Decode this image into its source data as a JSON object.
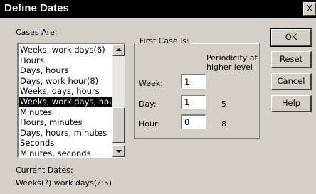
{
  "window": {
    "title": "Define Dates",
    "close_glyph": "X"
  },
  "cases_are": {
    "label": "Cases Are:",
    "items": [
      "Weeks, work days(6)",
      "Hours",
      "Days, hours",
      "Days, work hour(8)",
      "Weeks, days, hours",
      "Weeks, work days, hour",
      "Minutes",
      "Hours, minutes",
      "Days, hours, minutes",
      "Seconds",
      "Minutes, seconds"
    ],
    "selected": "Weeks, work days, hour"
  },
  "first_case": {
    "title": "First Case Is:",
    "periodicity_header": "Periodicity at higher level",
    "rows": [
      {
        "label": "Week:",
        "value": "1",
        "periodicity": ""
      },
      {
        "label": "Day:",
        "value": "1",
        "periodicity": "5"
      },
      {
        "label": "Hour:",
        "value": "0",
        "periodicity": "8"
      }
    ]
  },
  "buttons": {
    "ok": "OK",
    "reset": "Reset",
    "cancel": "Cancel",
    "help": "Help"
  },
  "current_dates": {
    "label": "Current Dates:",
    "value": "Weeks(?) work days(?;5)"
  },
  "icons": {
    "close": "close-icon",
    "scroll_up": "chevron-up-icon",
    "scroll_down": "chevron-down-icon"
  }
}
